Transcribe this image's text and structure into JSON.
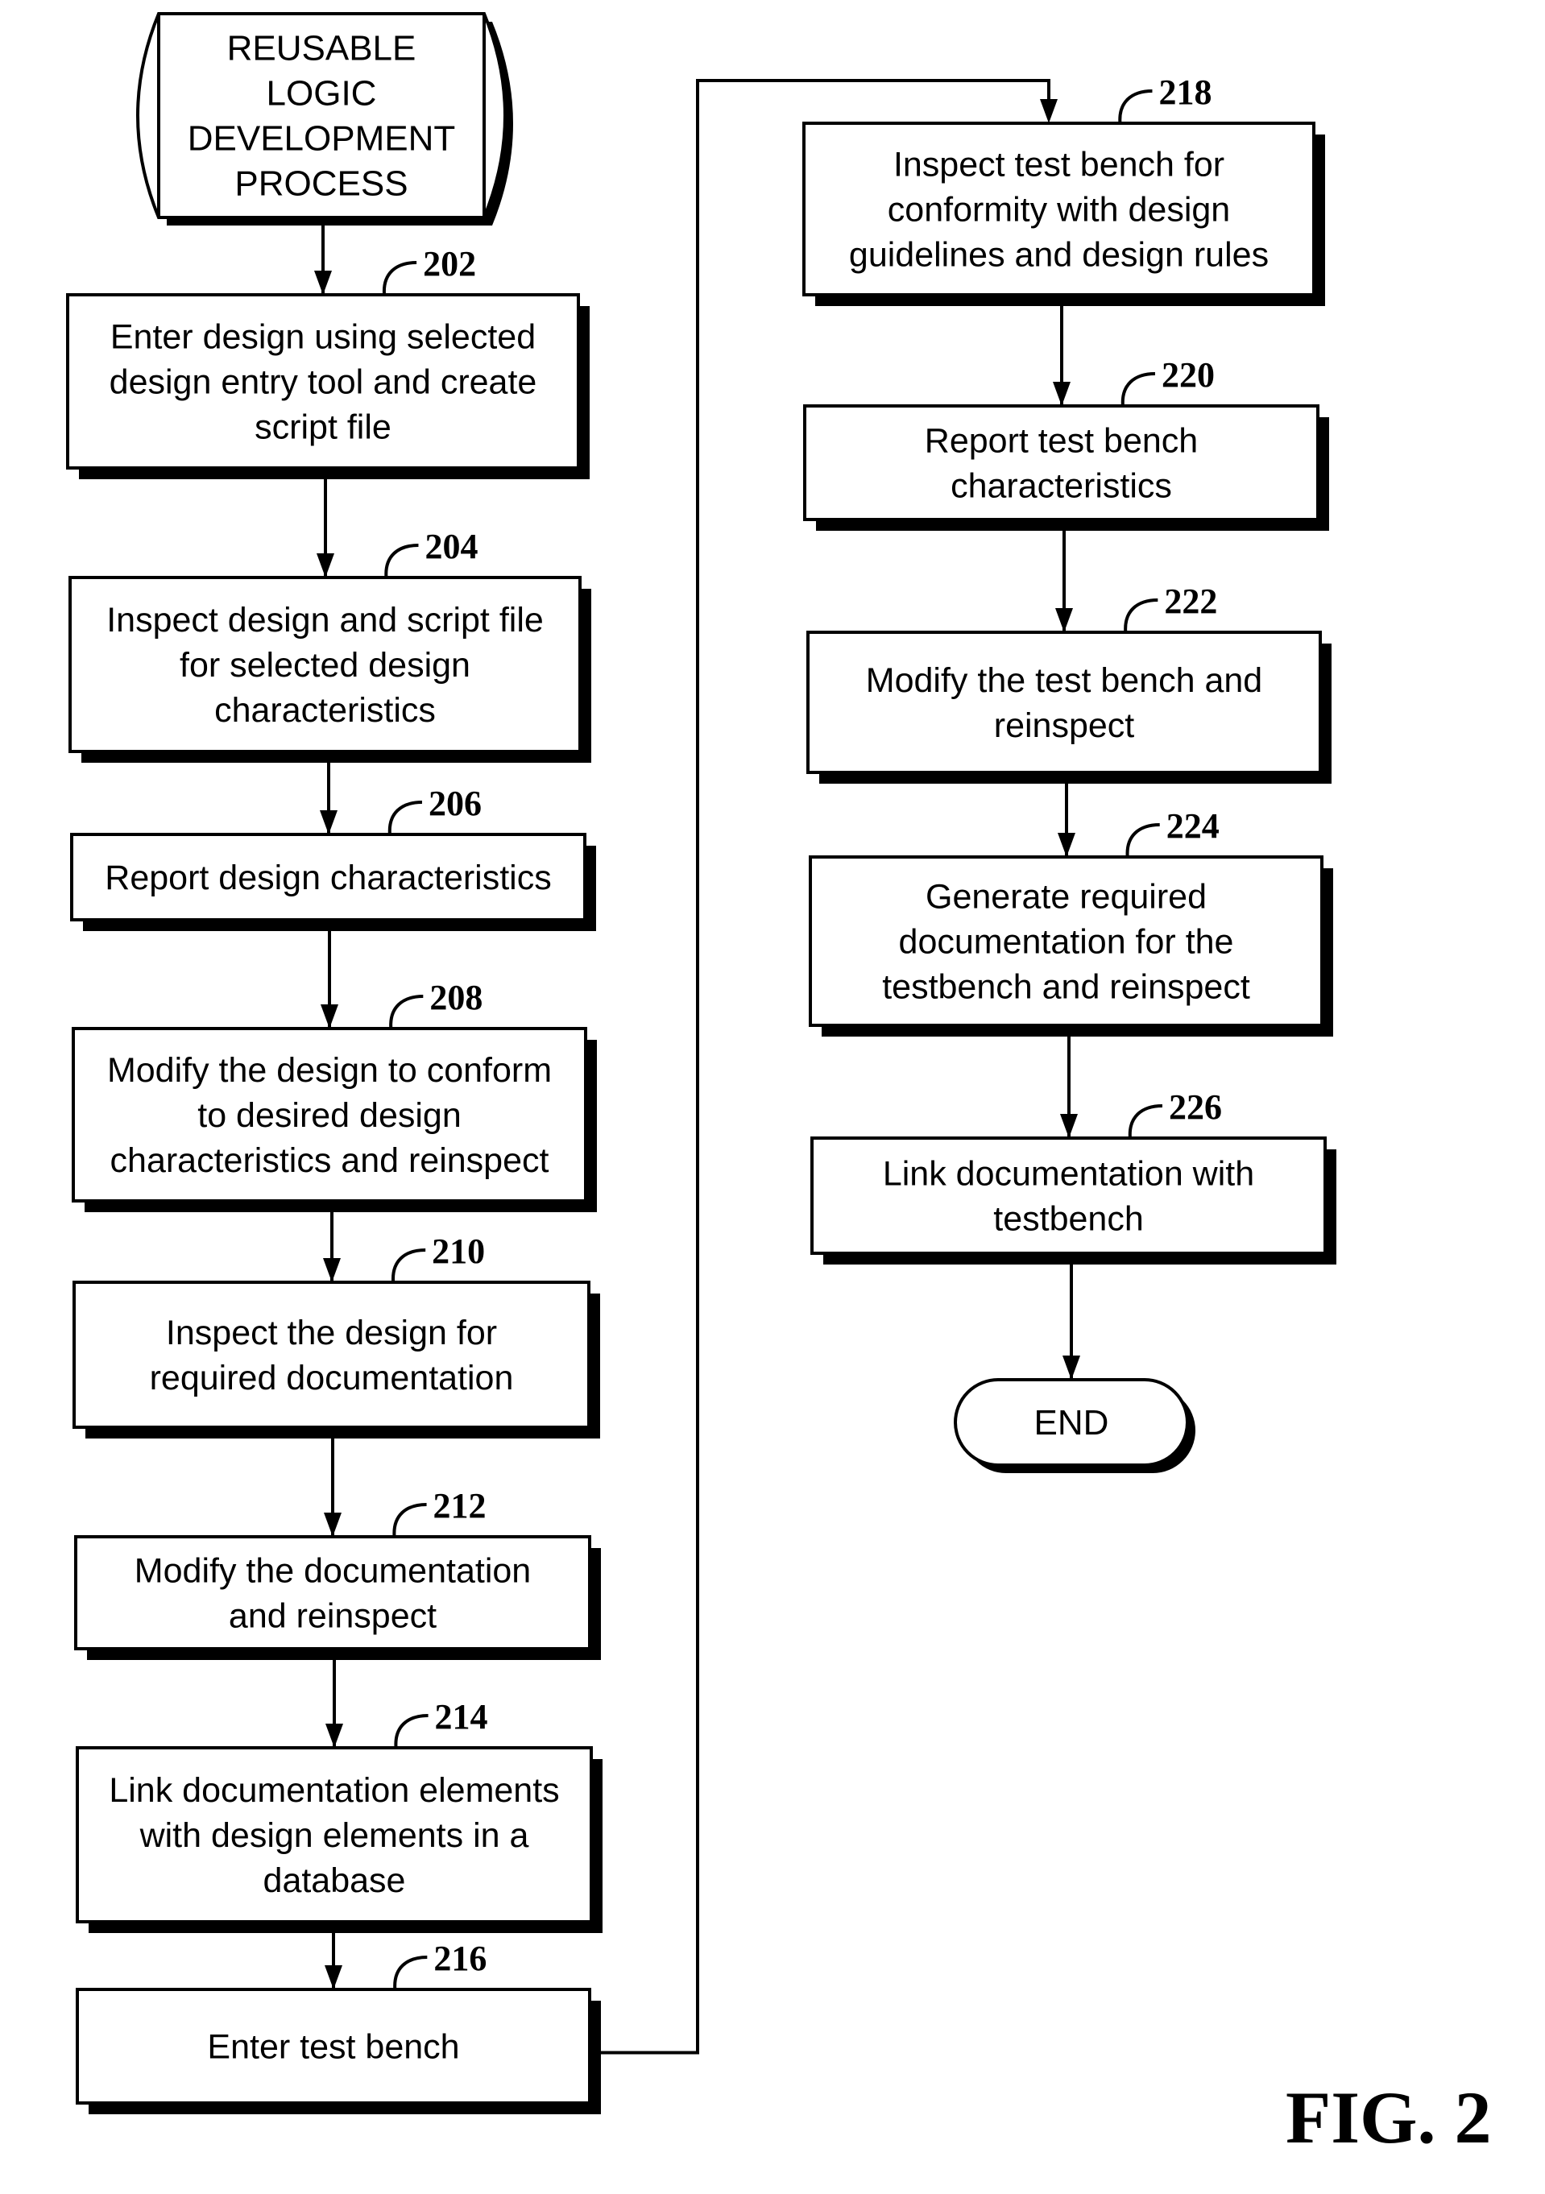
{
  "figure": {
    "label": "FIG. 2",
    "start": {
      "lines": [
        "REUSABLE",
        "LOGIC",
        "DEVELOPMENT",
        "PROCESS"
      ]
    },
    "end": {
      "lines": [
        "END"
      ]
    },
    "steps": [
      {
        "ref": "202",
        "column": "left",
        "lines": [
          "Enter design using selected",
          "design entry tool and create",
          "script file"
        ]
      },
      {
        "ref": "204",
        "column": "left",
        "lines": [
          "Inspect design and script file",
          "for selected design",
          "characteristics"
        ]
      },
      {
        "ref": "206",
        "column": "left",
        "lines": [
          "Report design characteristics"
        ]
      },
      {
        "ref": "208",
        "column": "left",
        "lines": [
          "Modify the design to conform",
          "to desired design",
          "characteristics and reinspect"
        ]
      },
      {
        "ref": "210",
        "column": "left",
        "lines": [
          "Inspect the design for",
          "required documentation"
        ]
      },
      {
        "ref": "212",
        "column": "left",
        "lines": [
          "Modify the documentation",
          "and reinspect"
        ]
      },
      {
        "ref": "214",
        "column": "left",
        "lines": [
          "Link documentation elements",
          "with design elements in a",
          "database"
        ]
      },
      {
        "ref": "216",
        "column": "left",
        "lines": [
          "Enter test bench"
        ]
      },
      {
        "ref": "218",
        "column": "right",
        "lines": [
          "Inspect test bench for",
          "conformity with design",
          "guidelines and design rules"
        ]
      },
      {
        "ref": "220",
        "column": "right",
        "lines": [
          "Report test bench",
          "characteristics"
        ]
      },
      {
        "ref": "222",
        "column": "right",
        "lines": [
          "Modify the test bench and",
          "reinspect"
        ]
      },
      {
        "ref": "224",
        "column": "right",
        "lines": [
          "Generate required",
          "documentation for the",
          "testbench and reinspect"
        ]
      },
      {
        "ref": "226",
        "column": "right",
        "lines": [
          "Link documentation with",
          "testbench"
        ]
      }
    ],
    "flow": [
      "start",
      "202",
      "204",
      "206",
      "208",
      "210",
      "212",
      "214",
      "216",
      "218",
      "220",
      "222",
      "224",
      "226",
      "end"
    ]
  }
}
